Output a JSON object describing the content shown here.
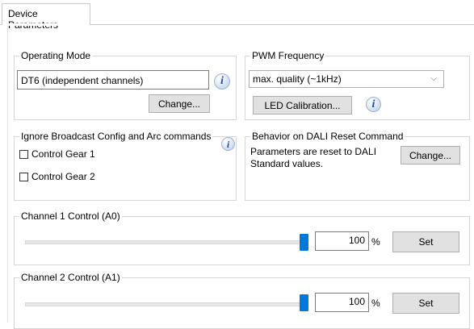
{
  "tab": {
    "label": "Device Parameters"
  },
  "operating_mode": {
    "title": "Operating Mode",
    "value": "DT6 (independent channels)",
    "change_label": "Change..."
  },
  "pwm_frequency": {
    "title": "PWM Frequency",
    "selected": "max. quality (~1kHz)",
    "led_calibration_label": "LED Calibration..."
  },
  "ignore_broadcast": {
    "title": "Ignore Broadcast Config and Arc commands",
    "gear1_label": "Control Gear 1",
    "gear2_label": "Control Gear 2",
    "gear1_checked": false,
    "gear2_checked": false
  },
  "dali_reset": {
    "title": "Behavior on DALI Reset Command",
    "text": "Parameters are reset to DALI Standard values.",
    "change_label": "Change..."
  },
  "channel1": {
    "title": "Channel 1 Control (A0)",
    "value": "100",
    "unit": "%",
    "set_label": "Set",
    "level_percent": 100
  },
  "channel2": {
    "title": "Channel 2 Control (A1)",
    "value": "100",
    "unit": "%",
    "set_label": "Set",
    "level_percent": 100
  },
  "colors": {
    "slider_thumb": "#0078d7",
    "info_icon": "#1d4aa3"
  },
  "icons": {
    "info": "info-icon",
    "dropdown": "chevron-down-icon"
  },
  "info_glyph": "i",
  "chevron_glyph": "⌵"
}
